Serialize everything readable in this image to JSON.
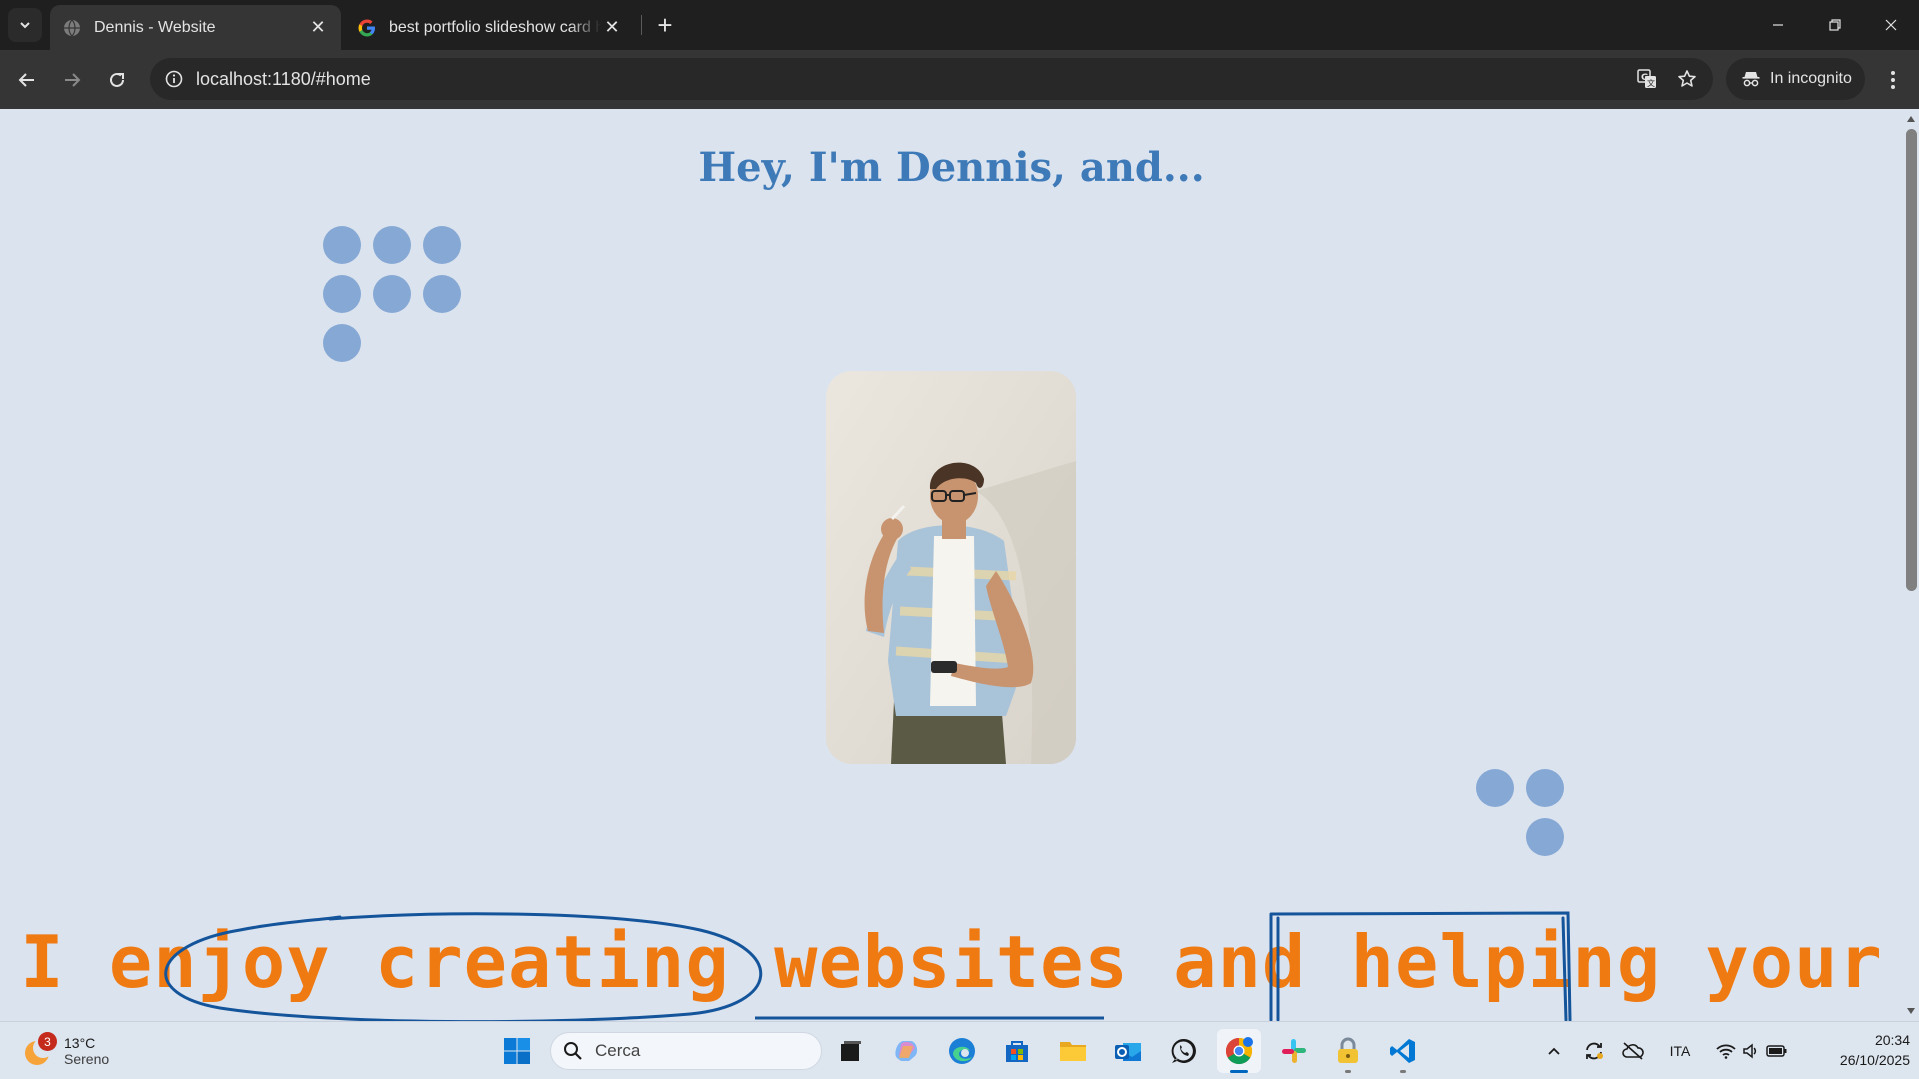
{
  "browser": {
    "tabs": [
      {
        "title": "Dennis - Website",
        "active": true
      },
      {
        "title": "best portfolio slideshow card html",
        "active": false
      }
    ],
    "url": "localhost:1180/#home",
    "incognito_label": "In incognito"
  },
  "page": {
    "greeting": "Hey, I'm Dennis, and...",
    "portrait_alt": "Dennis",
    "tagline": "I enjoy creating websites and helping your",
    "colors": {
      "background": "#dbe3ef",
      "accent_blue": "#3e7ab8",
      "accent_orange": "#f07a12",
      "dots": "#86a8d4",
      "scribble": "#14549a"
    }
  },
  "taskbar": {
    "weather": {
      "badge": "3",
      "temp": "13°C",
      "condition": "Sereno"
    },
    "search_placeholder": "Cerca",
    "apps": [
      "task-view",
      "copilot",
      "edge",
      "microsoft-store",
      "file-explorer",
      "outlook",
      "whatsapp",
      "chrome",
      "slack",
      "vpn",
      "vscode"
    ],
    "language": "ITA",
    "time": "20:34",
    "date": "26/10/2025"
  }
}
